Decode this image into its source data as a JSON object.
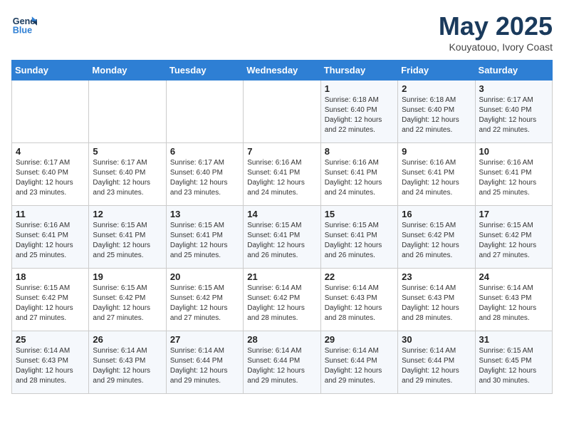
{
  "header": {
    "logo_line1": "General",
    "logo_line2": "Blue",
    "title": "May 2025",
    "subtitle": "Kouyatouo, Ivory Coast"
  },
  "days_of_week": [
    "Sunday",
    "Monday",
    "Tuesday",
    "Wednesday",
    "Thursday",
    "Friday",
    "Saturday"
  ],
  "weeks": [
    [
      {
        "day": "",
        "info": ""
      },
      {
        "day": "",
        "info": ""
      },
      {
        "day": "",
        "info": ""
      },
      {
        "day": "",
        "info": ""
      },
      {
        "day": "1",
        "info": "Sunrise: 6:18 AM\nSunset: 6:40 PM\nDaylight: 12 hours\nand 22 minutes."
      },
      {
        "day": "2",
        "info": "Sunrise: 6:18 AM\nSunset: 6:40 PM\nDaylight: 12 hours\nand 22 minutes."
      },
      {
        "day": "3",
        "info": "Sunrise: 6:17 AM\nSunset: 6:40 PM\nDaylight: 12 hours\nand 22 minutes."
      }
    ],
    [
      {
        "day": "4",
        "info": "Sunrise: 6:17 AM\nSunset: 6:40 PM\nDaylight: 12 hours\nand 23 minutes."
      },
      {
        "day": "5",
        "info": "Sunrise: 6:17 AM\nSunset: 6:40 PM\nDaylight: 12 hours\nand 23 minutes."
      },
      {
        "day": "6",
        "info": "Sunrise: 6:17 AM\nSunset: 6:40 PM\nDaylight: 12 hours\nand 23 minutes."
      },
      {
        "day": "7",
        "info": "Sunrise: 6:16 AM\nSunset: 6:41 PM\nDaylight: 12 hours\nand 24 minutes."
      },
      {
        "day": "8",
        "info": "Sunrise: 6:16 AM\nSunset: 6:41 PM\nDaylight: 12 hours\nand 24 minutes."
      },
      {
        "day": "9",
        "info": "Sunrise: 6:16 AM\nSunset: 6:41 PM\nDaylight: 12 hours\nand 24 minutes."
      },
      {
        "day": "10",
        "info": "Sunrise: 6:16 AM\nSunset: 6:41 PM\nDaylight: 12 hours\nand 25 minutes."
      }
    ],
    [
      {
        "day": "11",
        "info": "Sunrise: 6:16 AM\nSunset: 6:41 PM\nDaylight: 12 hours\nand 25 minutes."
      },
      {
        "day": "12",
        "info": "Sunrise: 6:15 AM\nSunset: 6:41 PM\nDaylight: 12 hours\nand 25 minutes."
      },
      {
        "day": "13",
        "info": "Sunrise: 6:15 AM\nSunset: 6:41 PM\nDaylight: 12 hours\nand 25 minutes."
      },
      {
        "day": "14",
        "info": "Sunrise: 6:15 AM\nSunset: 6:41 PM\nDaylight: 12 hours\nand 26 minutes."
      },
      {
        "day": "15",
        "info": "Sunrise: 6:15 AM\nSunset: 6:41 PM\nDaylight: 12 hours\nand 26 minutes."
      },
      {
        "day": "16",
        "info": "Sunrise: 6:15 AM\nSunset: 6:42 PM\nDaylight: 12 hours\nand 26 minutes."
      },
      {
        "day": "17",
        "info": "Sunrise: 6:15 AM\nSunset: 6:42 PM\nDaylight: 12 hours\nand 27 minutes."
      }
    ],
    [
      {
        "day": "18",
        "info": "Sunrise: 6:15 AM\nSunset: 6:42 PM\nDaylight: 12 hours\nand 27 minutes."
      },
      {
        "day": "19",
        "info": "Sunrise: 6:15 AM\nSunset: 6:42 PM\nDaylight: 12 hours\nand 27 minutes."
      },
      {
        "day": "20",
        "info": "Sunrise: 6:15 AM\nSunset: 6:42 PM\nDaylight: 12 hours\nand 27 minutes."
      },
      {
        "day": "21",
        "info": "Sunrise: 6:14 AM\nSunset: 6:42 PM\nDaylight: 12 hours\nand 28 minutes."
      },
      {
        "day": "22",
        "info": "Sunrise: 6:14 AM\nSunset: 6:43 PM\nDaylight: 12 hours\nand 28 minutes."
      },
      {
        "day": "23",
        "info": "Sunrise: 6:14 AM\nSunset: 6:43 PM\nDaylight: 12 hours\nand 28 minutes."
      },
      {
        "day": "24",
        "info": "Sunrise: 6:14 AM\nSunset: 6:43 PM\nDaylight: 12 hours\nand 28 minutes."
      }
    ],
    [
      {
        "day": "25",
        "info": "Sunrise: 6:14 AM\nSunset: 6:43 PM\nDaylight: 12 hours\nand 28 minutes."
      },
      {
        "day": "26",
        "info": "Sunrise: 6:14 AM\nSunset: 6:43 PM\nDaylight: 12 hours\nand 29 minutes."
      },
      {
        "day": "27",
        "info": "Sunrise: 6:14 AM\nSunset: 6:44 PM\nDaylight: 12 hours\nand 29 minutes."
      },
      {
        "day": "28",
        "info": "Sunrise: 6:14 AM\nSunset: 6:44 PM\nDaylight: 12 hours\nand 29 minutes."
      },
      {
        "day": "29",
        "info": "Sunrise: 6:14 AM\nSunset: 6:44 PM\nDaylight: 12 hours\nand 29 minutes."
      },
      {
        "day": "30",
        "info": "Sunrise: 6:14 AM\nSunset: 6:44 PM\nDaylight: 12 hours\nand 29 minutes."
      },
      {
        "day": "31",
        "info": "Sunrise: 6:15 AM\nSunset: 6:45 PM\nDaylight: 12 hours\nand 30 minutes."
      }
    ]
  ]
}
